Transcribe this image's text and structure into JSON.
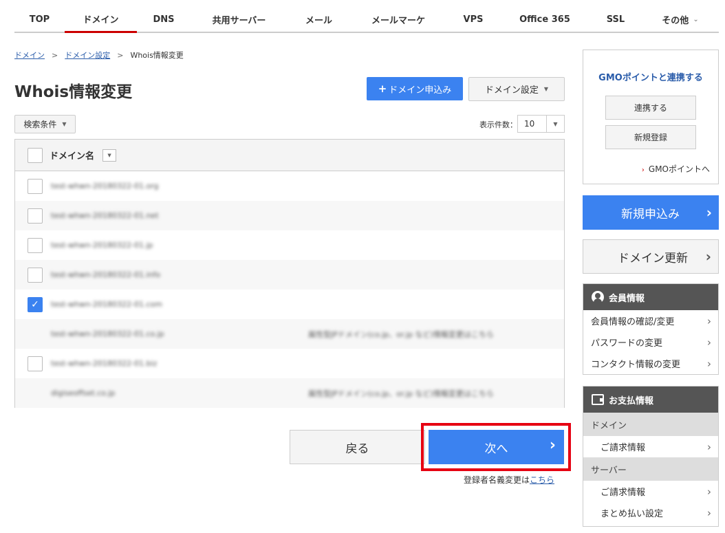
{
  "topnav": {
    "tabs": [
      {
        "label": "TOP"
      },
      {
        "label": "ドメイン"
      },
      {
        "label": "DNS"
      },
      {
        "label": "共用サーバー"
      },
      {
        "label": "メール"
      },
      {
        "label": "メールマーケ"
      },
      {
        "label": "VPS"
      },
      {
        "label": "Office 365"
      },
      {
        "label": "SSL"
      },
      {
        "label": "その他"
      }
    ],
    "active_tab": "ドメイン"
  },
  "breadcrumb": {
    "items": [
      "ドメイン",
      "ドメイン設定",
      "Whois情報変更"
    ],
    "separator": ">"
  },
  "page_title": "Whois情報変更",
  "toolbar": {
    "apply_label": "ドメイン申込み",
    "domain_settings_label": "ドメイン設定",
    "search_conditions_label": "検索条件",
    "per_page_label": "表示件数：",
    "per_page_value": "10"
  },
  "table": {
    "header": "ドメイン名",
    "rows": [
      {
        "domain": "test-whwn-20180322-01.org",
        "note": "",
        "checkbox": true,
        "checked": false
      },
      {
        "domain": "test-whwn-20180322-01.net",
        "note": "",
        "checkbox": true,
        "checked": false
      },
      {
        "domain": "test-whwn-20180322-01.jp",
        "note": "",
        "checkbox": true,
        "checked": false
      },
      {
        "domain": "test-whwn-20180322-01.info",
        "note": "",
        "checkbox": true,
        "checked": false
      },
      {
        "domain": "test-whwn-20180322-01.com",
        "note": "",
        "checkbox": true,
        "checked": true
      },
      {
        "domain": "test-whwn-20180322-01.co.jp",
        "note": "属性型JPドメイン(co.jp、or.jp など)情報変更はこちら",
        "checkbox": false,
        "checked": false
      },
      {
        "domain": "test-whwn-20180322-01.biz",
        "note": "",
        "checkbox": true,
        "checked": false
      },
      {
        "domain": "digiseoffset.co.jp",
        "note": "属性型JPドメイン(co.jp、or.jp など)情報変更はこちら",
        "checkbox": false,
        "checked": false
      }
    ]
  },
  "actions": {
    "back_label": "戻る",
    "next_label": "次へ",
    "registrant_note": "登録者名義変更は",
    "registrant_link": "こちら"
  },
  "sidebar": {
    "gmo": {
      "title": "GMOポイントと連携する",
      "link_button": "連携する",
      "register_button": "新規登録",
      "gmo_link": "GMOポイントへ"
    },
    "new_apply": "新規申込み",
    "domain_renew": "ドメイン更新",
    "member": {
      "title": "会員情報",
      "items": [
        "会員情報の確認/変更",
        "パスワードの変更",
        "コンタクト情報の変更"
      ]
    },
    "payment": {
      "title": "お支払情報",
      "group_domain": "ドメイン",
      "domain_billing": "ご請求情報",
      "group_server": "サーバー",
      "server_billing": "ご請求情報",
      "bulk_pay": "まとめ払い設定"
    }
  },
  "colors": {
    "accent": "#3b82f0",
    "active_tab": "#cc0000",
    "highlight_frame": "#e60012"
  }
}
